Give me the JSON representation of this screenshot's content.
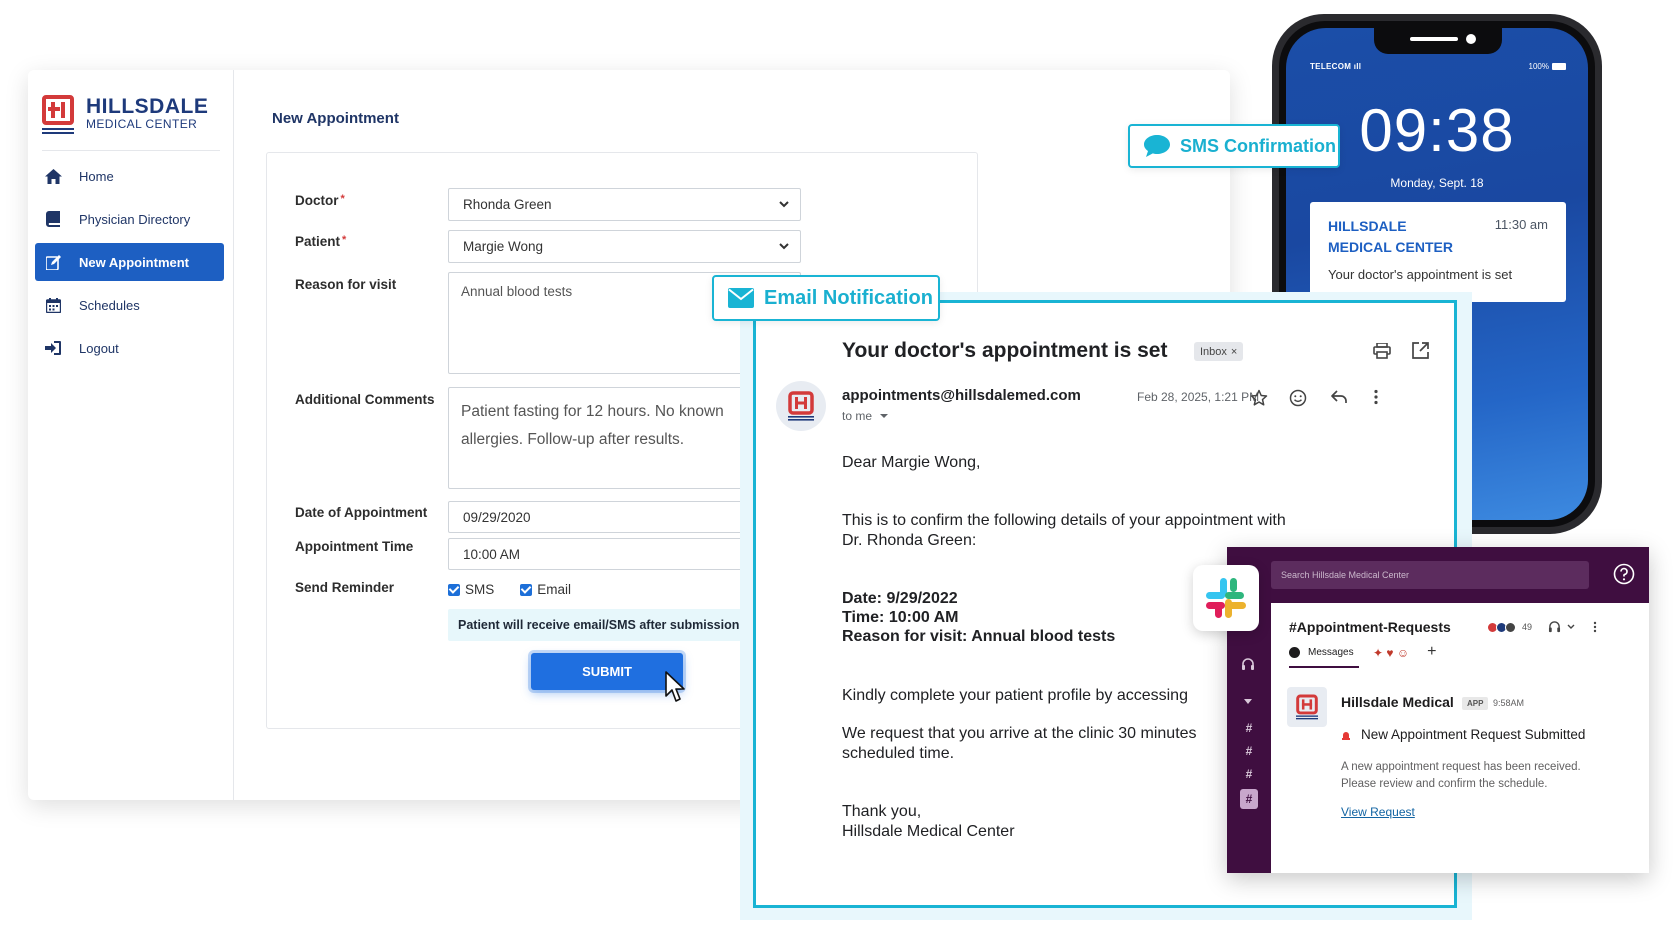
{
  "brand": {
    "name": "HILLSDALE",
    "sub": "MEDICAL CENTER"
  },
  "sidebar": {
    "items": [
      {
        "label": "Home",
        "icon": "home-icon"
      },
      {
        "label": "Physician Directory",
        "icon": "book-icon"
      },
      {
        "label": "New Appointment",
        "icon": "edit-icon"
      },
      {
        "label": "Schedules",
        "icon": "calendar-icon"
      },
      {
        "label": "Logout",
        "icon": "logout-icon"
      }
    ]
  },
  "form": {
    "title": "New Appointment",
    "doctor_label": "Doctor",
    "doctor_value": "Rhonda Green",
    "patient_label": "Patient",
    "patient_value": "Margie Wong",
    "reason_label": "Reason for visit",
    "reason_value": "Annual blood tests",
    "comments_label": "Additional Comments",
    "comments_line1": "Patient fasting for 12 hours. No known",
    "comments_line2": "allergies. Follow-up after results.",
    "date_label": "Date of Appointment",
    "date_value": "09/29/2020",
    "time_label": "Appointment Time",
    "time_value": "10:00 AM",
    "reminder_label": "Send Reminder",
    "sms_label": "SMS",
    "email_label": "Email",
    "notice": "Patient will receive email/SMS after submission",
    "submit_label": "SUBMIT"
  },
  "tags": {
    "sms": "SMS Confirmation",
    "email": "Email Notification"
  },
  "phone": {
    "carrier": "TELECOM",
    "battery": "100%",
    "time": "09:38",
    "date": "Monday, Sept. 18",
    "notif_brand": "HILLSDALE MEDICAL CENTER",
    "notif_time": "11:30 am",
    "notif_msg": "Your doctor's appointment is set"
  },
  "email": {
    "subject": "Your doctor's appointment is set",
    "label": "Inbox",
    "label_close": "×",
    "from": "appointments@hillsdalemed.com",
    "to": "to me",
    "date": "Feb 28, 2025, 1:21 PM",
    "greeting": "Dear Margie Wong,",
    "intro1": "This is to confirm the following details of your appointment with",
    "intro2": "Dr. Rhonda Green:",
    "detail_date": "Date: 9/29/2022",
    "detail_time": "Time: 10:00 AM",
    "detail_reason": "Reason for visit: Annual blood tests",
    "line_profile": "Kindly complete your patient profile by accessing",
    "line_arrive1": "We request that you arrive at the clinic 30 minutes",
    "line_arrive2": "scheduled time.",
    "sign1": "Thank you,",
    "sign2": "Hillsdale Medical Center"
  },
  "slack": {
    "search_placeholder": "Search Hillsdale Medical Center",
    "channel": "#Appointment-Requests",
    "member_count": "49",
    "tab_messages": "Messages",
    "sender": "Hillsdale Medical",
    "app_badge": "APP",
    "time": "9:58AM",
    "title": "New Appointment Request Submitted",
    "desc": "A new appointment request has been received. Please review and confirm the schedule.",
    "link": "View Request",
    "rail_hash": "#"
  },
  "colors": {
    "brand_red": "#d33a3a",
    "brand_navy": "#1e3a7b",
    "accent_blue": "#1d5fc2",
    "cyan": "#19b4d4",
    "slack_purple": "#3f0e40"
  }
}
